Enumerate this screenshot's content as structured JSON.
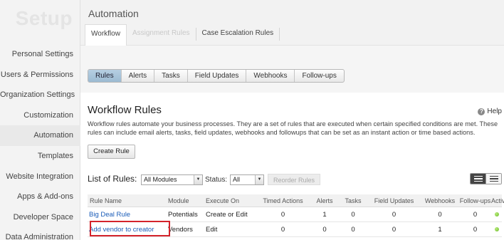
{
  "sidebar": {
    "title": "Setup",
    "items": [
      {
        "label": "Personal Settings"
      },
      {
        "label": "Users & Permissions"
      },
      {
        "label": "Organization Settings"
      },
      {
        "label": "Customization"
      },
      {
        "label": "Automation"
      },
      {
        "label": "Templates"
      },
      {
        "label": "Website Integration"
      },
      {
        "label": "Apps & Add-ons"
      },
      {
        "label": "Developer Space"
      },
      {
        "label": "Data Administration"
      }
    ],
    "active_item": "Automation"
  },
  "header": {
    "title": "Automation",
    "subtabs": [
      "Workflow",
      "Assignment Rules",
      "Case Escalation Rules"
    ]
  },
  "tabs": [
    "Rules",
    "Alerts",
    "Tasks",
    "Field Updates",
    "Webhooks",
    "Follow-ups"
  ],
  "main": {
    "title": "Workflow Rules",
    "help": "Help",
    "description": "Workflow rules automate your business processes. They are a set of rules that are executed when certain specified conditions are met. These rules can include email alerts, tasks, field updates, webhooks and followups that can be set as an instant action or time based actions.",
    "create_button": "Create Rule",
    "list_label": "List of Rules:",
    "module_select": "All Modules",
    "status_label": "Status:",
    "status_select": "All",
    "reorder_button": "Reorder Rules"
  },
  "table": {
    "headers": [
      "Rule Name",
      "Module",
      "Execute On",
      "Timed Actions",
      "Alerts",
      "Tasks",
      "Field Updates",
      "Webhooks",
      "Follow-ups",
      "Active"
    ],
    "rows": [
      {
        "name": "Big Deal Rule",
        "module": "Potentials",
        "execute_on": "Create or Edit",
        "timed": "0",
        "alerts": "1",
        "tasks": "0",
        "field_updates": "0",
        "webhooks": "0",
        "followups": "0",
        "active": true
      },
      {
        "name": "Add vendor to creator",
        "module": "Vendors",
        "execute_on": "Edit",
        "timed": "0",
        "alerts": "0",
        "tasks": "0",
        "field_updates": "0",
        "webhooks": "1",
        "followups": "0",
        "active": true
      }
    ]
  },
  "colors": {
    "link": "#1a5cb8",
    "highlight": "#d4232b",
    "active_dot": "#6dbb2c",
    "active_tab": "#9cbad2"
  }
}
